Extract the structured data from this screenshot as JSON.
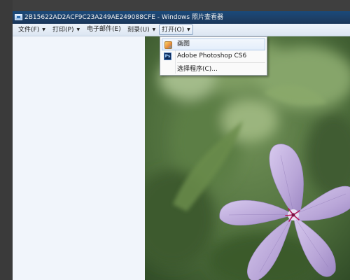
{
  "window": {
    "title": "2B15622AD2ACF9C23A249AE249088CFE - Windows 照片查看器"
  },
  "menubar": {
    "items": [
      {
        "label": "文件(F)",
        "has_arrow": true
      },
      {
        "label": "打印(P)",
        "has_arrow": true
      },
      {
        "label": "电子邮件(E)",
        "has_arrow": false
      },
      {
        "label": "刻录(U)",
        "has_arrow": true
      },
      {
        "label": "打开(O)",
        "has_arrow": true,
        "active": true
      }
    ],
    "arrow_glyph": "▼"
  },
  "open_menu": {
    "items": [
      {
        "label": "画图",
        "icon": "paint-icon"
      },
      {
        "label": "Adobe Photoshop CS6",
        "icon": "photoshop-icon",
        "icon_text": "Ps"
      },
      {
        "label": "选择程序(C)...",
        "icon": null
      }
    ]
  },
  "colors": {
    "titlebar": "#1d3f66",
    "sidebar": "#f1f5fb",
    "flower_petal": "#b9a6d8",
    "flower_center": "#b01a5a"
  }
}
